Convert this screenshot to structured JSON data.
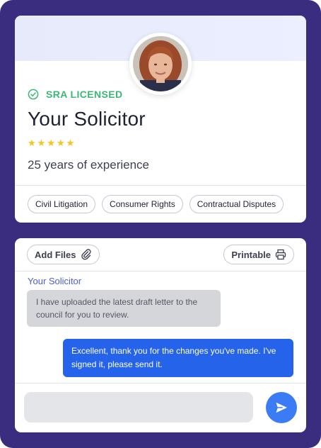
{
  "profile": {
    "license_label": "SRA LICENSED",
    "name": "Your Solicitor",
    "rating_stars": 5,
    "experience": "25 years of experience",
    "specialties": [
      "Civil Litigation",
      "Consumer Rights",
      "Contractual Disputes"
    ]
  },
  "toolbar": {
    "add_files_label": "Add Files",
    "printable_label": "Printable"
  },
  "messages": [
    {
      "direction": "incoming",
      "sender": "Your Solicitor",
      "text": "I have uploaded the latest draft letter to the council for you to review."
    },
    {
      "direction": "outgoing",
      "text": "Excellent, thank you for the changes you've made. I've signed it, please send it."
    }
  ],
  "composer": {
    "value": "",
    "placeholder": ""
  },
  "colors": {
    "frame": "#3a2c7e",
    "licensed": "#3bb974",
    "accent_blue": "#2563eb",
    "send_button": "#3b7cf5",
    "star": "#f5c518"
  },
  "icons": {
    "license": "check-circle-icon",
    "add_files": "paperclip-icon",
    "printable": "printer-icon",
    "send": "send-icon"
  }
}
